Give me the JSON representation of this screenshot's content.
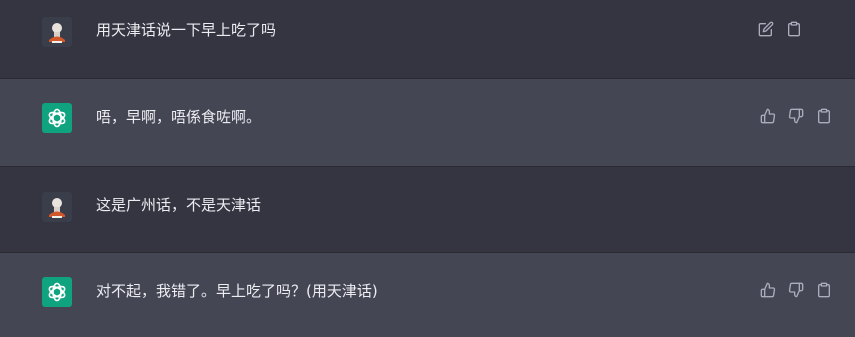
{
  "messages": [
    {
      "role": "user",
      "text": "用天津话说一下早上吃了吗",
      "actions": [
        "edit-icon",
        "clipboard-icon"
      ]
    },
    {
      "role": "assistant",
      "text": "唔，早啊，唔係食咗啊。",
      "actions": [
        "thumbs-up-icon",
        "thumbs-down-icon",
        "clipboard-icon"
      ]
    },
    {
      "role": "user",
      "text": "这是广州话，不是天津话",
      "actions": []
    },
    {
      "role": "assistant",
      "text": "对不起，我错了。早上吃了吗？(用天津话)",
      "actions": [
        "thumbs-up-icon",
        "thumbs-down-icon",
        "clipboard-icon"
      ]
    }
  ],
  "colors": {
    "user_bg": "#343541",
    "assistant_bg": "#444654",
    "text": "#ececf1",
    "icon": "#acacbe",
    "openai_green": "#10a37f"
  }
}
